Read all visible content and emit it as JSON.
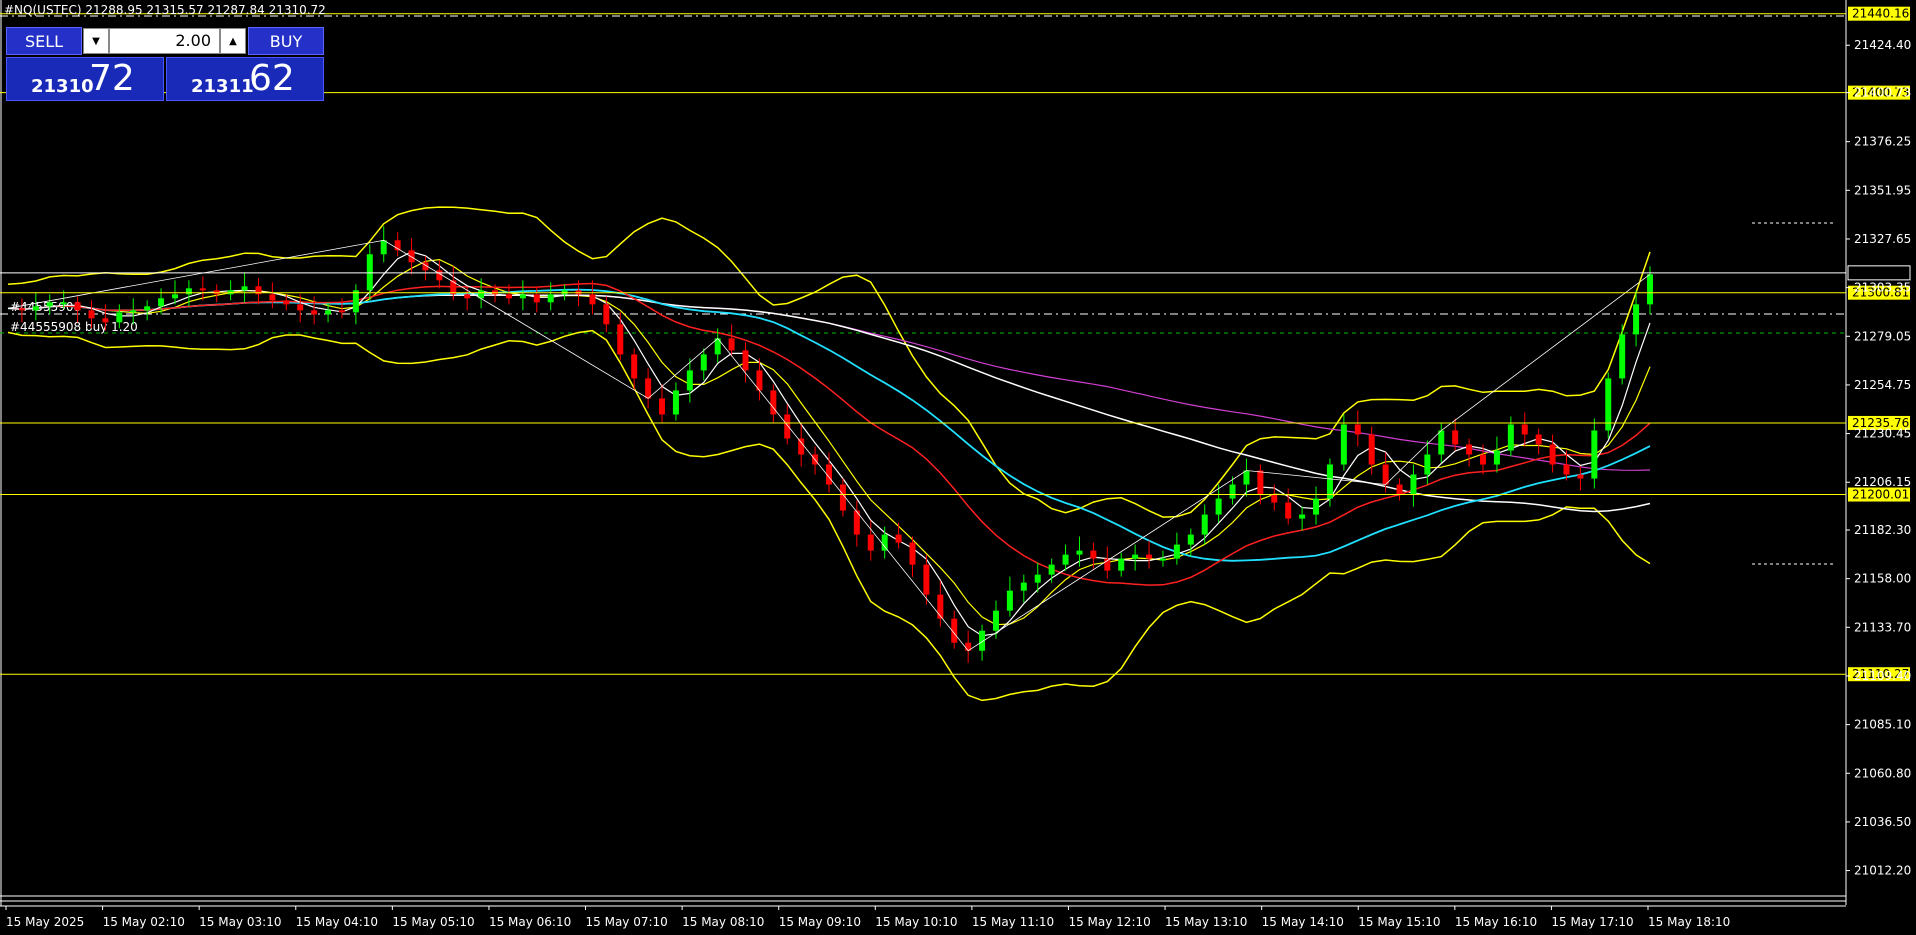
{
  "header": {
    "ohlc_text": "#NQ(USTEC) 21288.95 21315.57 21287.84 21310.72"
  },
  "trade_panel": {
    "sell_label": "SELL",
    "buy_label": "BUY",
    "lot_value": "2.00",
    "sell_price_small": "21310",
    "sell_price_big": "72",
    "buy_price_small": "21311",
    "buy_price_big": "62"
  },
  "order_labels": [
    "#44555908",
    "#44555908 buy 1.20"
  ],
  "colors": {
    "background": "#000000",
    "bull_candle": "#00ff00",
    "bear_candle": "#ff0000",
    "bollinger": "#ffff00",
    "ma_red": "#ff2020",
    "ma_cyan": "#20e0ff",
    "ma_white": "#ffffff",
    "ma_magenta": "#d040d0",
    "level_line": "#ffff00",
    "trade_button": "#2430c8"
  },
  "chart_data": {
    "type": "candlestick",
    "symbol_ohlc": {
      "open": 21288.95,
      "high": 21315.57,
      "low": 21287.84,
      "close": 21310.72
    },
    "ylim": [
      21000,
      21445
    ],
    "y_ticks": [
      "21424.40",
      "21400.73",
      "21376.25",
      "21351.95",
      "21327.65",
      "21303.35",
      "21279.05",
      "21254.75",
      "21230.45",
      "21206.15",
      "21182.30",
      "21158.00",
      "21133.70",
      "21109.40",
      "21085.10",
      "21060.80",
      "21036.50",
      "21012.20"
    ],
    "x_ticks": [
      "15 May 2025",
      "15 May 02:10",
      "15 May 03:10",
      "15 May 04:10",
      "15 May 05:10",
      "15 May 06:10",
      "15 May 07:10",
      "15 May 08:10",
      "15 May 09:10",
      "15 May 10:10",
      "15 May 11:10",
      "15 May 12:10",
      "15 May 13:10",
      "15 May 14:10",
      "15 May 15:10",
      "15 May 16:10",
      "15 May 17:10",
      "15 May 18:10"
    ],
    "horizontal_levels": [
      {
        "value": 21440.16,
        "label": "21440.16",
        "highlight": true
      },
      {
        "value": 21400.73,
        "label": "21400.73",
        "highlight": true
      },
      {
        "value": 21310.72,
        "label": "21310.72",
        "highlight": false
      },
      {
        "value": 21300.81,
        "label": "21300.81",
        "highlight": true
      },
      {
        "value": 21235.76,
        "label": "21235.76",
        "highlight": true
      },
      {
        "value": 21200.01,
        "label": "21200.01",
        "highlight": true
      },
      {
        "value": 21110.27,
        "label": "21110.27",
        "highlight": true
      }
    ],
    "close_path": [
      21293,
      21292,
      21294,
      21296,
      21296,
      21292,
      21288,
      21286,
      21291,
      21292,
      21294,
      21298,
      21300,
      21303,
      21302,
      21300,
      21302,
      21304,
      21300,
      21297,
      21295,
      21292,
      21290,
      21292,
      21291,
      21302,
      21320,
      21327,
      21322,
      21316,
      21312,
      21307,
      21300,
      21298,
      21302,
      21300,
      21298,
      21300,
      21296,
      21300,
      21302,
      21300,
      21295,
      21285,
      21270,
      21258,
      21248,
      21240,
      21252,
      21262,
      21270,
      21278,
      21272,
      21262,
      21252,
      21240,
      21228,
      21220,
      21215,
      21205,
      21192,
      21180,
      21172,
      21180,
      21176,
      21165,
      21150,
      21138,
      21126,
      21122,
      21132,
      21142,
      21152,
      21156,
      21160,
      21165,
      21170,
      21172,
      21168,
      21162,
      21168,
      21170,
      21168,
      21168,
      21175,
      21180,
      21190,
      21198,
      21205,
      21212,
      21200,
      21196,
      21188,
      21190,
      21198,
      21215,
      21235,
      21230,
      21215,
      21205,
      21200,
      21210,
      21220,
      21232,
      21225,
      21220,
      21215,
      21222,
      21235,
      21230,
      21225,
      21215,
      21210,
      21208,
      21232,
      21258,
      21280,
      21295,
      21310
    ],
    "moving_averages": [
      "red",
      "cyan",
      "white",
      "magenta"
    ],
    "bollinger_bands": true
  }
}
